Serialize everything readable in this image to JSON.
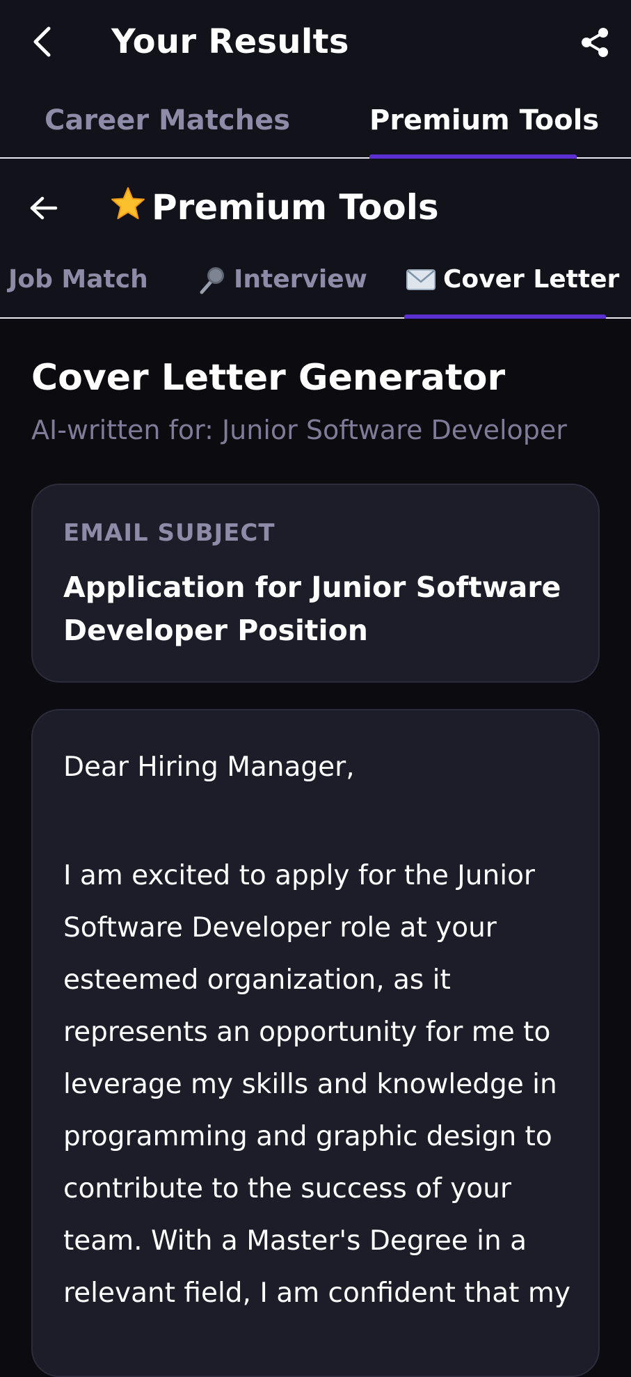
{
  "header": {
    "title": "Your Results",
    "tabs": [
      {
        "label": "Career Matches"
      },
      {
        "label": "Premium Tools"
      }
    ],
    "active_tab": "Premium Tools"
  },
  "premium_tools": {
    "title": "Premium Tools",
    "title_icon": "star-icon",
    "tabs": [
      {
        "label": "Job Match",
        "icon": ""
      },
      {
        "label": "Interview",
        "icon": "microphone-icon"
      },
      {
        "label": "Cover Letter",
        "icon": "envelope-icon"
      }
    ],
    "active_tab": "Cover Letter"
  },
  "cover_letter": {
    "heading": "Cover Letter Generator",
    "subheading": "AI-written for: Junior Software Developer",
    "subject_label": "EMAIL SUBJECT",
    "subject": "Application for Junior Software Developer Position",
    "greeting": "Dear Hiring Manager,",
    "body_lines": [
      "I am excited to apply for the Junior",
      "Software Developer role at your",
      "esteemed organization, as it",
      "represents an opportunity for me to",
      "leverage my skills and knowledge in",
      "programming and graphic design to",
      "contribute to the success of your",
      "team. With a Master's Degree in a",
      "relevant field, I am confident that my"
    ]
  },
  "colors": {
    "background": "#0b0b10",
    "bar_background": "#11121a",
    "card_background": "#1d1d2a",
    "accent": "#5b2fd0",
    "muted_text": "#8e8aa8"
  }
}
